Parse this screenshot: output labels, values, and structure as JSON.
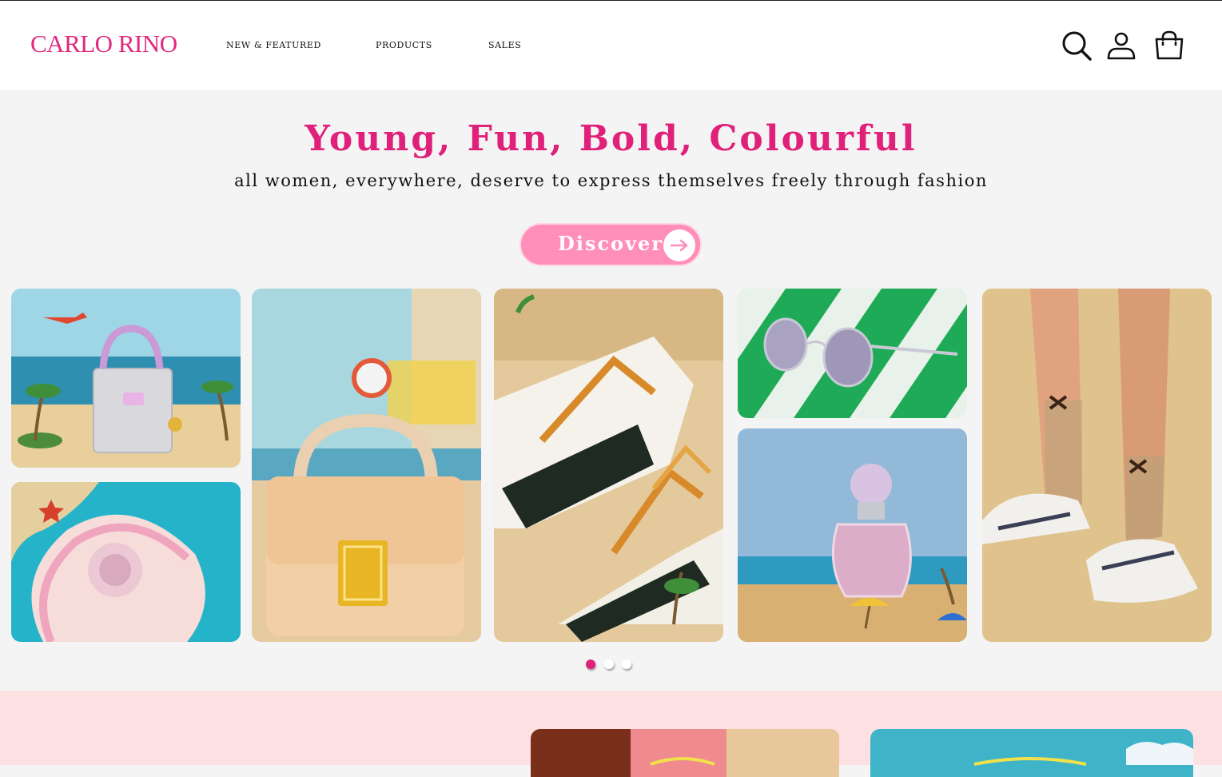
{
  "header": {
    "logo": "CARLO RINO",
    "nav": [
      "NEW & FEATURED",
      "PRODUCTS",
      "SALES"
    ],
    "icons": [
      "search-icon",
      "account-icon",
      "bag-icon"
    ]
  },
  "hero": {
    "title": "Young, Fun, Bold, Colourful",
    "subtitle": "all women, everywhere, deserve to express themselves freely through fashion",
    "cta_label": "Discover",
    "cta_icon": "arrow-right-icon"
  },
  "carousel": {
    "tiles": [
      "handbag-beach",
      "scarf-shell",
      "top-handle-bag",
      "sneakers",
      "sunglasses",
      "perfume",
      "legs-sneakers"
    ],
    "dots": 3,
    "active_dot": 1
  },
  "colors": {
    "brand_pink": "#e0217a",
    "cta_pink": "#ff8eb9",
    "band_pink": "#fde0e2"
  }
}
